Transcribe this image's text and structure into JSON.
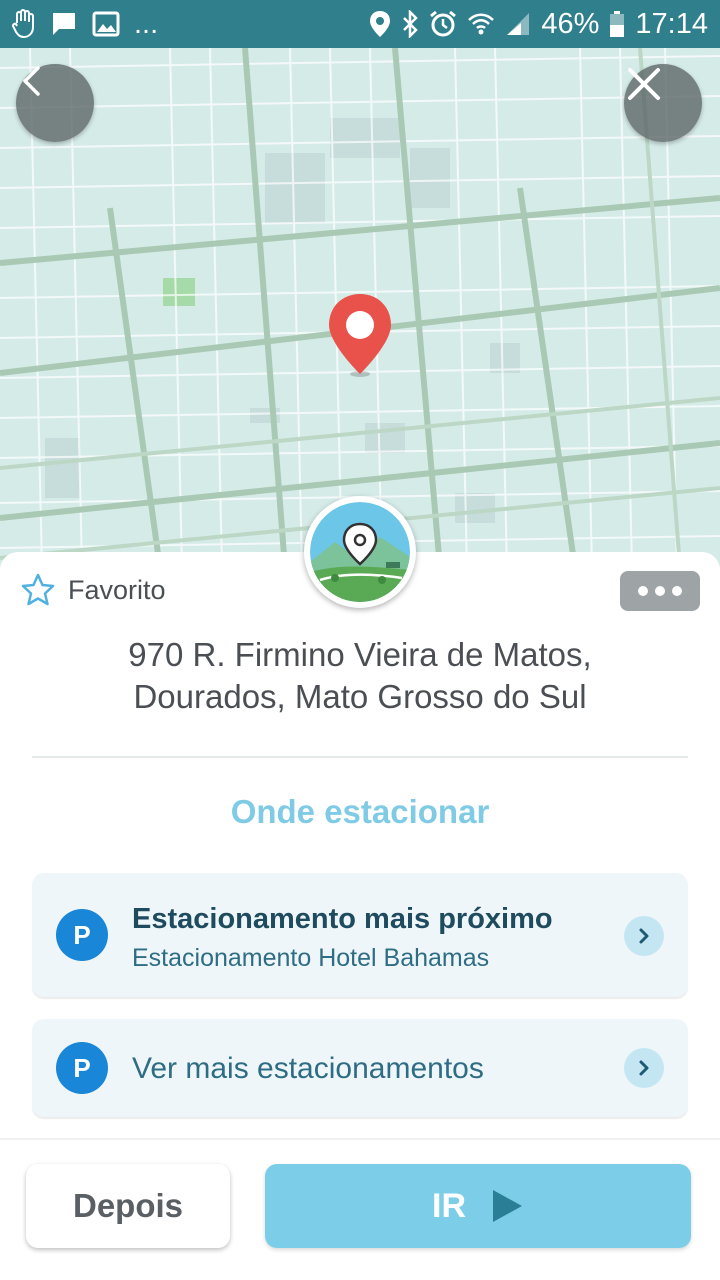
{
  "status_bar": {
    "battery": "46%",
    "time": "17:14",
    "icons": [
      "hand-icon",
      "chat-icon",
      "image-icon",
      "more-icon",
      "location-icon",
      "bluetooth-icon",
      "alarm-icon",
      "wifi-icon",
      "signal-icon",
      "battery-icon"
    ],
    "more": "..."
  },
  "map": {
    "back_icon": "chevron-left-icon",
    "close_icon": "close-icon",
    "pin_color": "#e8524b"
  },
  "sheet": {
    "favorite_label": "Favorito",
    "address_line1": "970 R. Firmino Vieira de Matos,",
    "address_line2": "Dourados, Mato Grosso do Sul",
    "parking_title": "Onde estacionar",
    "nearest": {
      "badge": "P",
      "title": "Estacionamento mais próximo",
      "subtitle": "Estacionamento Hotel Bahamas"
    },
    "more_parking": {
      "badge": "P",
      "title": "Ver mais estacionamentos"
    }
  },
  "actions": {
    "later_label": "Depois",
    "go_label": "IR"
  },
  "colors": {
    "status_bar": "#2f7f8c",
    "accent": "#7ccee8",
    "parking_badge": "#1a86d8",
    "title_text": "#1e4b5d"
  }
}
